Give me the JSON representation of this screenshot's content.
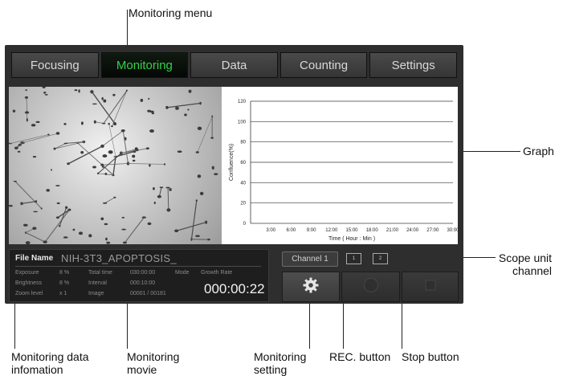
{
  "callouts": {
    "monitoring_menu": "Monitoring menu",
    "graph": "Graph",
    "scope_unit_channel_line1": "Scope unit",
    "scope_unit_channel_line2": "channel",
    "monitoring_data_line1": "Monitoring data",
    "monitoring_data_line2": "infomation",
    "monitoring_movie_line1": "Monitoring",
    "monitoring_movie_line2": "movie",
    "monitoring_setting_line1": "Monitoring",
    "monitoring_setting_line2": "setting",
    "rec_button": "REC. button",
    "stop_button": "Stop button"
  },
  "tabs": [
    {
      "label": "Focusing",
      "active": false
    },
    {
      "label": "Monitoring",
      "active": true
    },
    {
      "label": "Data",
      "active": false
    },
    {
      "label": "Counting",
      "active": false
    },
    {
      "label": "Settings",
      "active": false
    }
  ],
  "info": {
    "file_name_label": "File Name",
    "file_name": "NIH-3T3_APOPTOSIS_",
    "exposure_label": "Exposure",
    "exposure_value": "8 %",
    "brightness_label": "Brightness",
    "brightness_value": "8 %",
    "zoom_label": "Zoom level",
    "zoom_value": "x 1",
    "total_time_label": "Total time",
    "total_time_value": "030:00:00",
    "interval_label": "Interval",
    "interval_value": "000:10:00",
    "image_label": "Image",
    "image_value": "00001 / 00181",
    "mode_label": "Mode",
    "mode_value": "Growth Rate",
    "elapsed": "000:00:22"
  },
  "controls": {
    "channel_label": "Channel 1",
    "channel_options": [
      "1",
      "2"
    ],
    "settings_icon": "gear-icon",
    "rec_icon": "record-circle-icon",
    "stop_icon": "stop-square-icon"
  },
  "colors": {
    "active_tab_text": "#35d14a",
    "panel_bg": "#2e2e2e"
  },
  "chart_data": {
    "type": "line",
    "xlabel": "Time ( Hour : Min )",
    "ylabel": "Confluence(%)",
    "x_ticks": [
      "3:00",
      "6:00",
      "9:00",
      "12:00",
      "15:00",
      "18:00",
      "21:00",
      "24:00",
      "27:00",
      "30:00"
    ],
    "y_ticks": [
      0,
      20,
      40,
      60,
      80,
      100,
      120
    ],
    "ylim": [
      0,
      120
    ],
    "grid": true,
    "series": []
  }
}
